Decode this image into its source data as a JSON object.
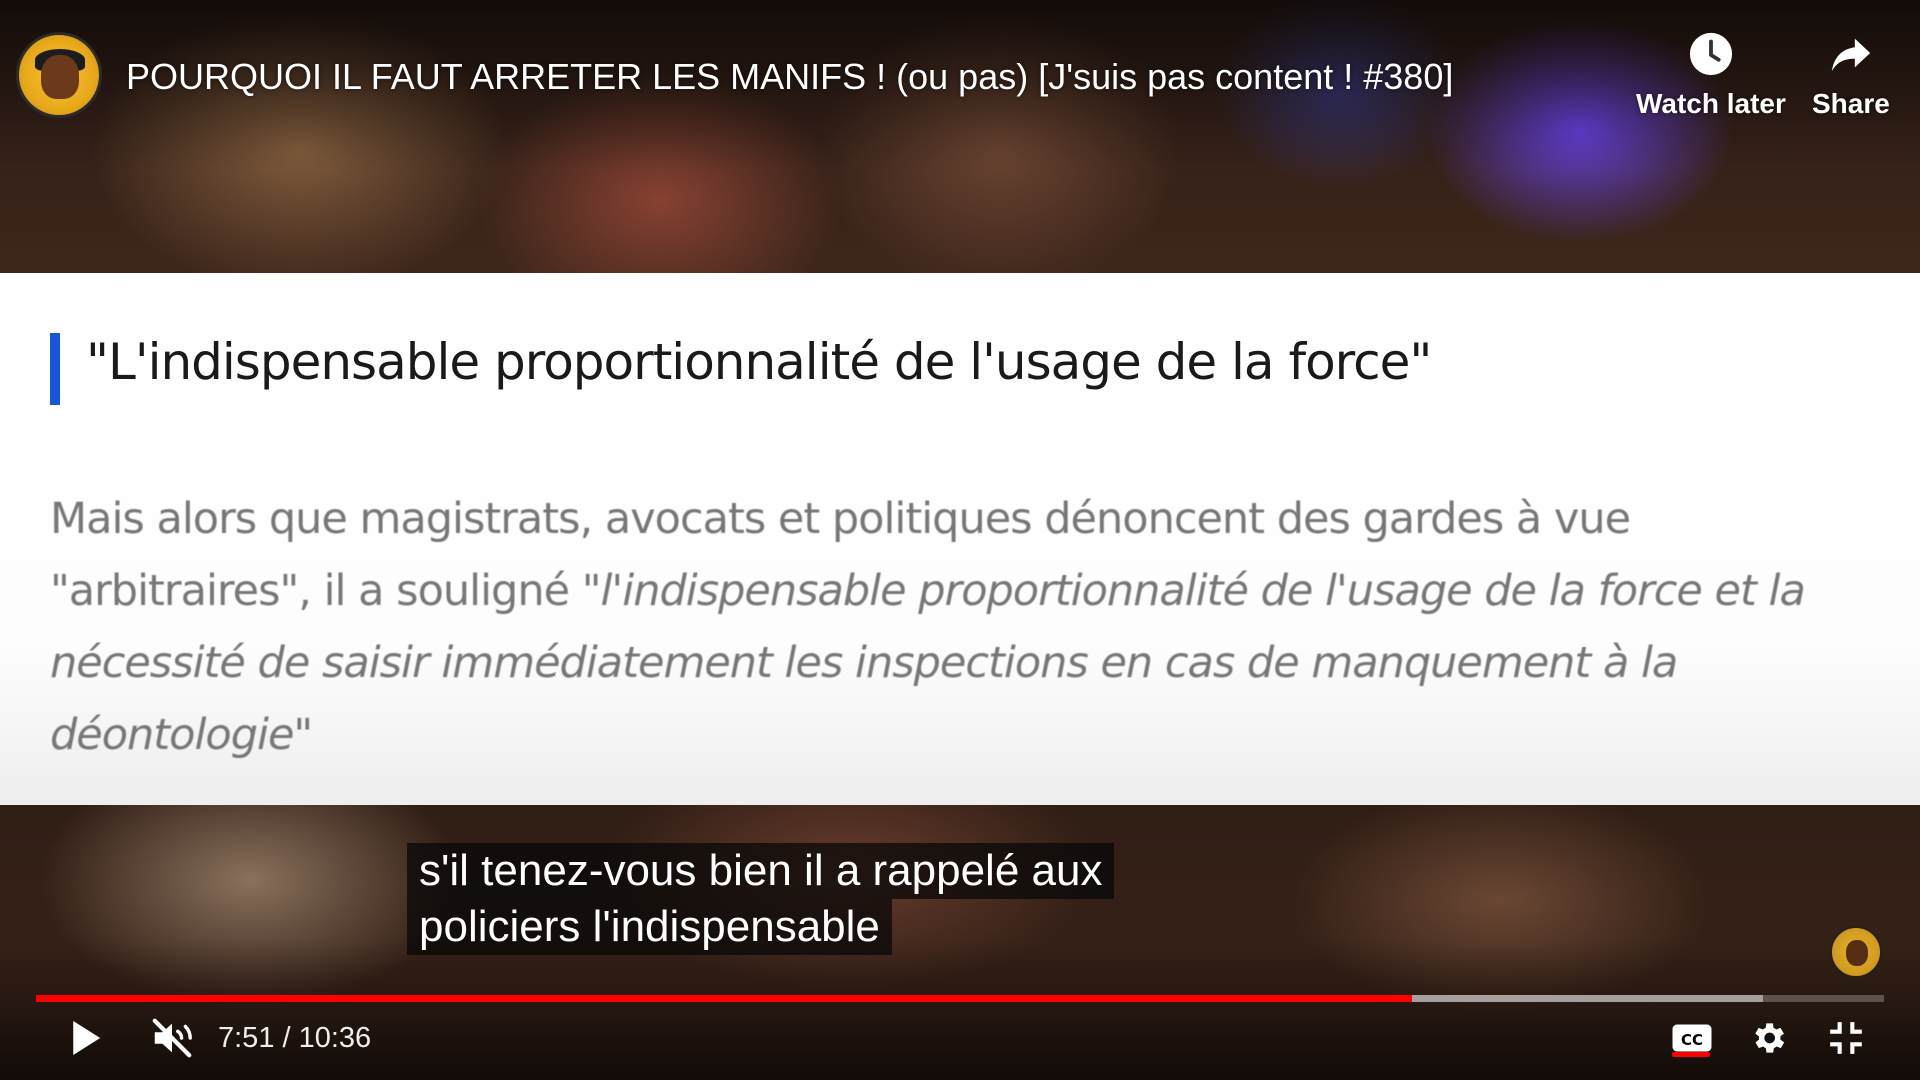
{
  "header": {
    "title": "POURQUOI IL FAUT ARRETER LES MANIFS ! (ou pas) [J'suis pas content ! #380]",
    "watch_later_label": "Watch later",
    "share_label": "Share"
  },
  "article": {
    "heading": "\"L'indispensable proportionnalité de l'usage de la force\"",
    "body_plain": "Mais alors que magistrats, avocats et politiques dénoncent des gardes à vue \"arbitraires\", il a souligné ",
    "body_quote": "\"l'indispensable proportionnalité de l'usage de la force et la nécessité de saisir immédiatement les inspections en cas de manquement à la déontologie\""
  },
  "captions": {
    "line1": "s'il tenez-vous bien il a rappelé aux",
    "line2": "policiers l'indispensable"
  },
  "player": {
    "time_display": "7:51 / 10:36",
    "progress_played_fraction": 0.7444,
    "progress_buffered_fraction": 0.9346,
    "captions_enabled": true,
    "muted": true,
    "accent_color": "#ff0000"
  },
  "icons": {
    "play": "play-icon",
    "mute": "volume-muted-icon",
    "cc": "closed-captions-icon",
    "settings": "gear-icon",
    "exit_fullscreen": "exit-fullscreen-icon",
    "watch_later": "clock-icon",
    "share": "share-arrow-icon"
  }
}
